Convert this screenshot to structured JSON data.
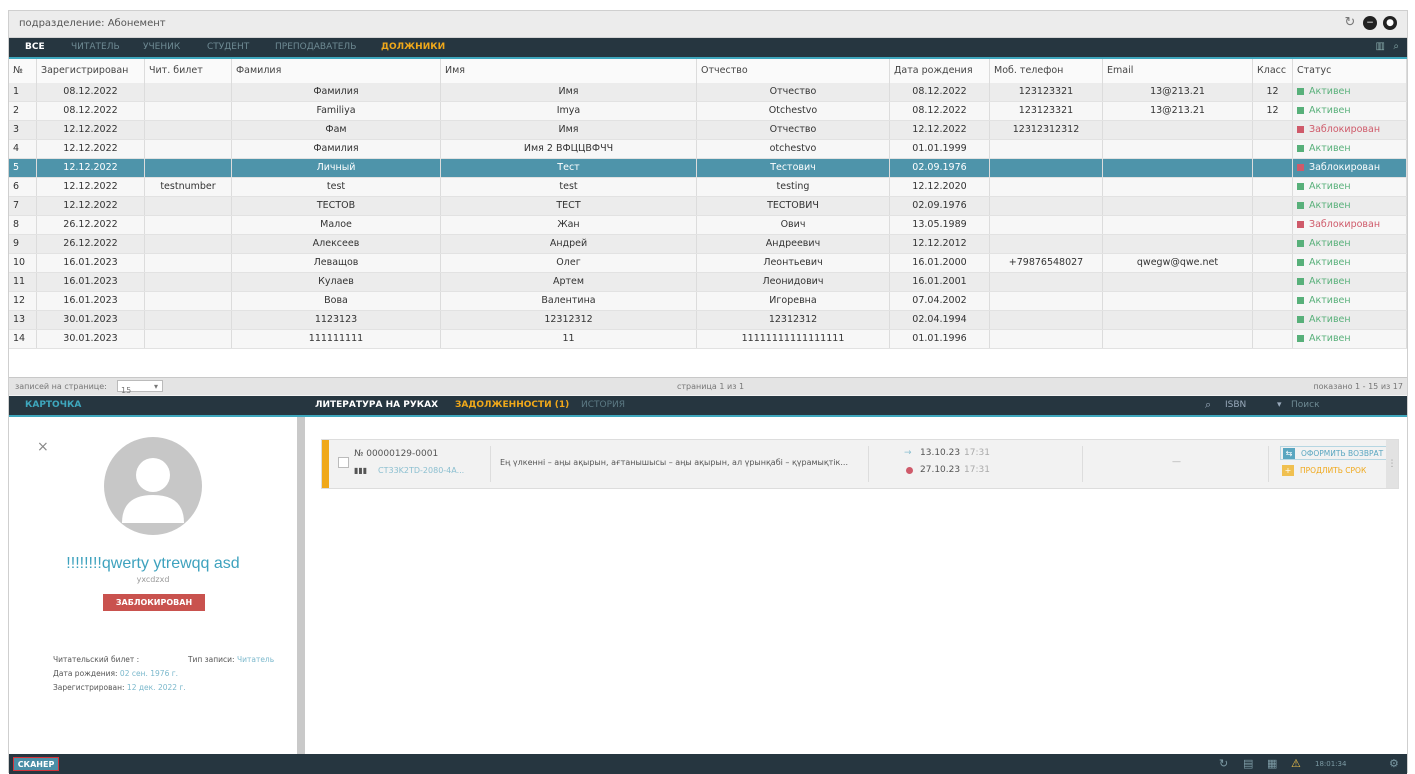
{
  "window": {
    "title": "подразделение: Абонемент"
  },
  "nav": {
    "tabs": [
      "ВСЕ",
      "ЧИТАТЕЛЬ",
      "УЧЕНИК",
      "СТУДЕНТ",
      "ПРЕПОДАВАТЕЛЬ",
      "ДОЛЖНИКИ"
    ]
  },
  "table": {
    "headers": [
      "№",
      "Зарегистрирован",
      "Чит. билет",
      "Фамилия",
      "Имя",
      "Отчество",
      "Дата рождения",
      "Моб. телефон",
      "Email",
      "Класс",
      "Статус"
    ],
    "rows": [
      [
        "1",
        "08.12.2022",
        "",
        "Фамилия",
        "Имя",
        "Отчество",
        "08.12.2022",
        "123123321",
        "13@213.21",
        "12",
        "Активен"
      ],
      [
        "2",
        "08.12.2022",
        "",
        "Familiya",
        "Imya",
        "Otchestvo",
        "08.12.2022",
        "123123321",
        "13@213.21",
        "12",
        "Активен"
      ],
      [
        "3",
        "12.12.2022",
        "",
        "Фам",
        "Имя",
        "Отчество",
        "12.12.2022",
        "12312312312",
        "",
        "",
        "Заблокирован"
      ],
      [
        "4",
        "12.12.2022",
        "",
        "Фамилия",
        "Имя 2 ВФЦЦВФЧЧ",
        "otchestvo",
        "01.01.1999",
        "",
        "",
        "",
        "Активен"
      ],
      [
        "5",
        "12.12.2022",
        "",
        "Личный",
        "Тест",
        "Тестович",
        "02.09.1976",
        "",
        "",
        "",
        "Заблокирован"
      ],
      [
        "6",
        "12.12.2022",
        "testnumber",
        "test",
        "test",
        "testing",
        "12.12.2020",
        "",
        "",
        "",
        "Активен"
      ],
      [
        "7",
        "12.12.2022",
        "",
        "ТЕСТОВ",
        "ТЕСТ",
        "ТЕСТОВИЧ",
        "02.09.1976",
        "",
        "",
        "",
        "Активен"
      ],
      [
        "8",
        "26.12.2022",
        "",
        "Малое",
        "Жан",
        "Ович",
        "13.05.1989",
        "",
        "",
        "",
        "Заблокирован"
      ],
      [
        "9",
        "26.12.2022",
        "",
        "Алексеев",
        "Андрей",
        "Андреевич",
        "12.12.2012",
        "",
        "",
        "",
        "Активен"
      ],
      [
        "10",
        "16.01.2023",
        "",
        "Леващов",
        "Олег",
        "Леонтьевич",
        "16.01.2000",
        "+79876548027",
        "qwegw@qwe.net",
        "",
        "Активен"
      ],
      [
        "11",
        "16.01.2023",
        "",
        "Кулаев",
        "Артем",
        "Леонидович",
        "16.01.2001",
        "",
        "",
        "",
        "Активен"
      ],
      [
        "12",
        "16.01.2023",
        "",
        "Вова",
        "Валентина",
        "Игоревна",
        "07.04.2002",
        "",
        "",
        "",
        "Активен"
      ],
      [
        "13",
        "30.01.2023",
        "",
        "1123123",
        "12312312",
        "12312312",
        "02.04.1994",
        "",
        "",
        "",
        "Активен"
      ],
      [
        "14",
        "30.01.2023",
        "",
        "111111111",
        "11",
        "11111111111111111",
        "01.01.1996",
        "",
        "",
        "",
        "Активен"
      ]
    ],
    "selected_row": 5
  },
  "pager": {
    "per_page_label": "записей на странице:",
    "per_page_value": "15",
    "page_info": "страница 1 из 1",
    "count_info": "показано 1 - 15 из 17"
  },
  "panel": {
    "left_tab": "КАРТОЧКА",
    "tabs": [
      "ЛИТЕРАТУРА НА РУКАХ",
      "ЗАДОЛЖЕННОСТИ (1)",
      "ИСТОРИЯ"
    ],
    "filter": "ISBN",
    "search_placeholder": "Поиск"
  },
  "card": {
    "close": "×",
    "name": "!!!!!!!!qwerty ytrewqq asd",
    "login": "yxcdzxd",
    "status_badge": "ЗАБЛОКИРОВАН",
    "reader_ticket_label": "Читательский билет :",
    "record_type_label": "Тип записи:",
    "record_type_value": "Читатель",
    "birth_label": "Дата рождения:",
    "birth_value": "02 сен. 1976 г.",
    "registered_label": "Зарегистрирован:",
    "registered_value": "12 дек. 2022 г."
  },
  "loan": {
    "number": "№ 00000129-0001",
    "code": "CT33K2TD-2080-4A...",
    "title": "Ең үлкенні – аңы ақырын, ағтанышысы – аңы ақырын, ал үрынқабі – қүрамықтік...",
    "issued_date": "13.10.23",
    "issued_time": "17:31",
    "due_date": "27.10.23",
    "due_time": "17:31",
    "middle": "—",
    "btn_return": "ОФОРМИТЬ ВОЗВРАТ",
    "btn_extend": "ПРОДЛИТЬ СРОК"
  },
  "bottom": {
    "scanner": "СКАНЕР",
    "clock": "18:01:34"
  },
  "colors": {
    "dark_bar": "#263640",
    "accent": "#3ea7bd",
    "orange": "#f0a81a",
    "active": "#58b07a",
    "blocked": "#cf5a6a",
    "selected_row": "#4e94aa"
  }
}
